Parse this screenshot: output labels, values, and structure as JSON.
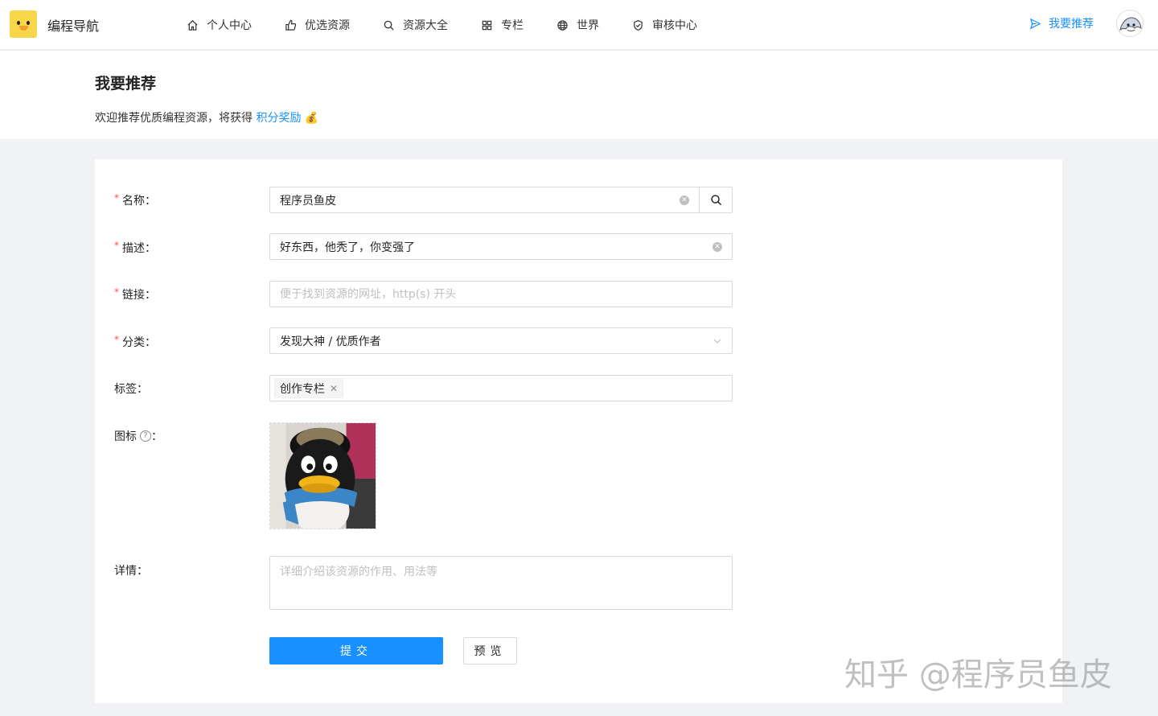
{
  "app": {
    "brand": "编程导航"
  },
  "nav": {
    "items": [
      {
        "label": "个人中心",
        "icon": "home-icon"
      },
      {
        "label": "优选资源",
        "icon": "thumbs-up-icon"
      },
      {
        "label": "资源大全",
        "icon": "search-icon"
      },
      {
        "label": "专栏",
        "icon": "grid-icon"
      },
      {
        "label": "世界",
        "icon": "globe-icon"
      },
      {
        "label": "审核中心",
        "icon": "shield-check-icon"
      }
    ],
    "recommend_label": "我要推荐",
    "recommend_icon": "send-icon"
  },
  "header": {
    "title": "我要推荐",
    "subtitle_text": "欢迎推荐优质编程资源，将获得",
    "subtitle_link": "积分奖励",
    "subtitle_emoji": "💰"
  },
  "form": {
    "name_label": "名称",
    "name_value": "程序员鱼皮",
    "desc_label": "描述",
    "desc_value": "好东西，他秃了，你变强了",
    "link_label": "链接",
    "link_placeholder": "便于找到资源的网址，http(s) 开头",
    "category_label": "分类",
    "category_value": "发现大神 / 优质作者",
    "tags_label": "标签",
    "tags": [
      "创作专栏"
    ],
    "icon_label": "图标",
    "detail_label": "详情",
    "detail_placeholder": "详细介绍该资源的作用、用法等",
    "colon": "：",
    "required_mark": "*",
    "submit_label": "提交",
    "preview_label": "预览"
  },
  "watermark": "知乎 @程序员鱼皮",
  "colors": {
    "primary": "#1890ff",
    "required": "#ff4d4f",
    "page_bg": "#f0f2f5"
  }
}
